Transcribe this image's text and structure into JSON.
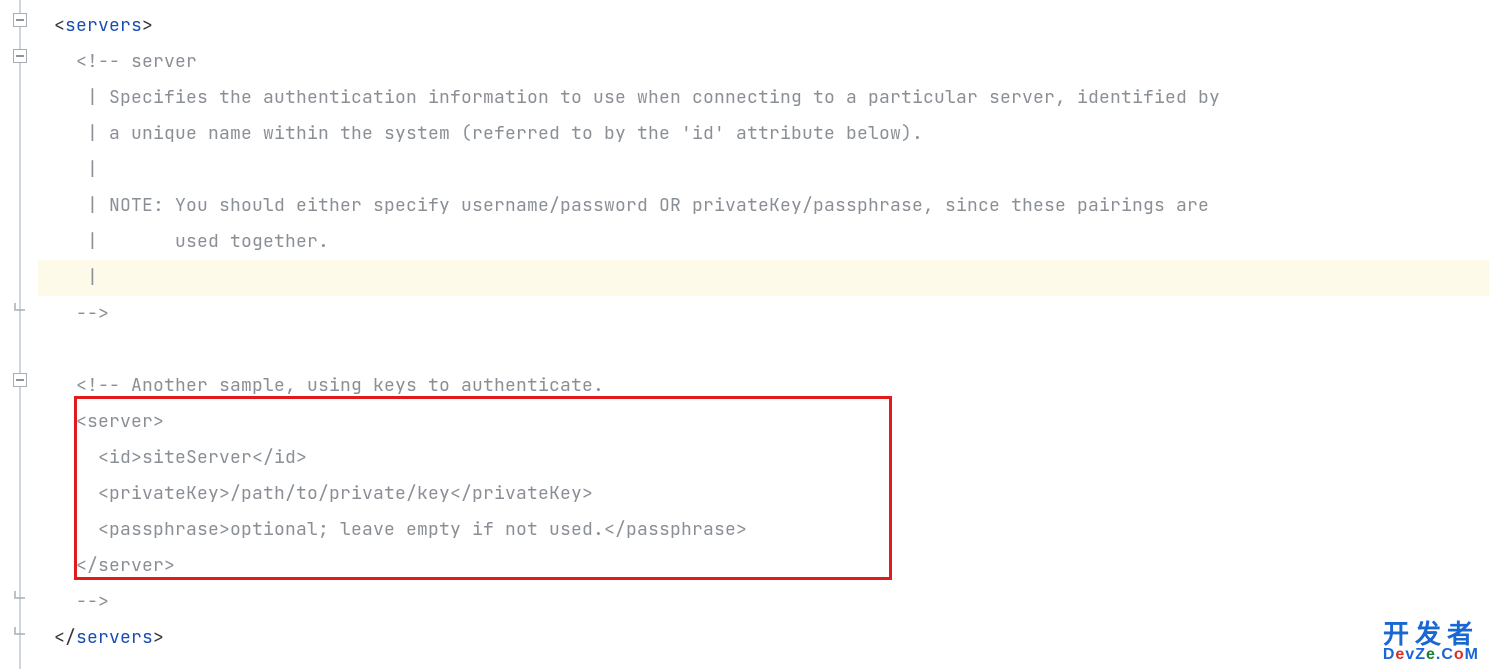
{
  "code": {
    "indent1": "  ",
    "indent2": "    ",
    "indent3": "      ",
    "lt": "<",
    "gt": ">",
    "ltSlash": "</",
    "tag_servers": "servers",
    "comment_start": "<!-- server",
    "comment_l1": " | Specifies the authentication information to use when connecting to a particular server, identified by",
    "comment_l2": " | a unique name within the system (referred to by the 'id' attribute below).",
    "comment_l3": " |",
    "comment_l4": " | NOTE: You should either specify username/password OR privateKey/passphrase, since these pairings are",
    "comment_l5": " |       used together.",
    "comment_l6": " |",
    "comment_end": "-->",
    "blank": "",
    "comment2_start": "<!-- Another sample, using keys to authenticate.",
    "server_open": "<server>",
    "id_line": "  <id>siteServer</id>",
    "pk_line": "  <privateKey>/path/to/private/key</privateKey>",
    "pp_line": "  <passphrase>optional; leave empty if not used.</passphrase>",
    "server_close": "</server>",
    "comment2_end": "-->"
  },
  "watermark": {
    "zh": "开发者",
    "en_plain": "DevZe.CoM"
  }
}
